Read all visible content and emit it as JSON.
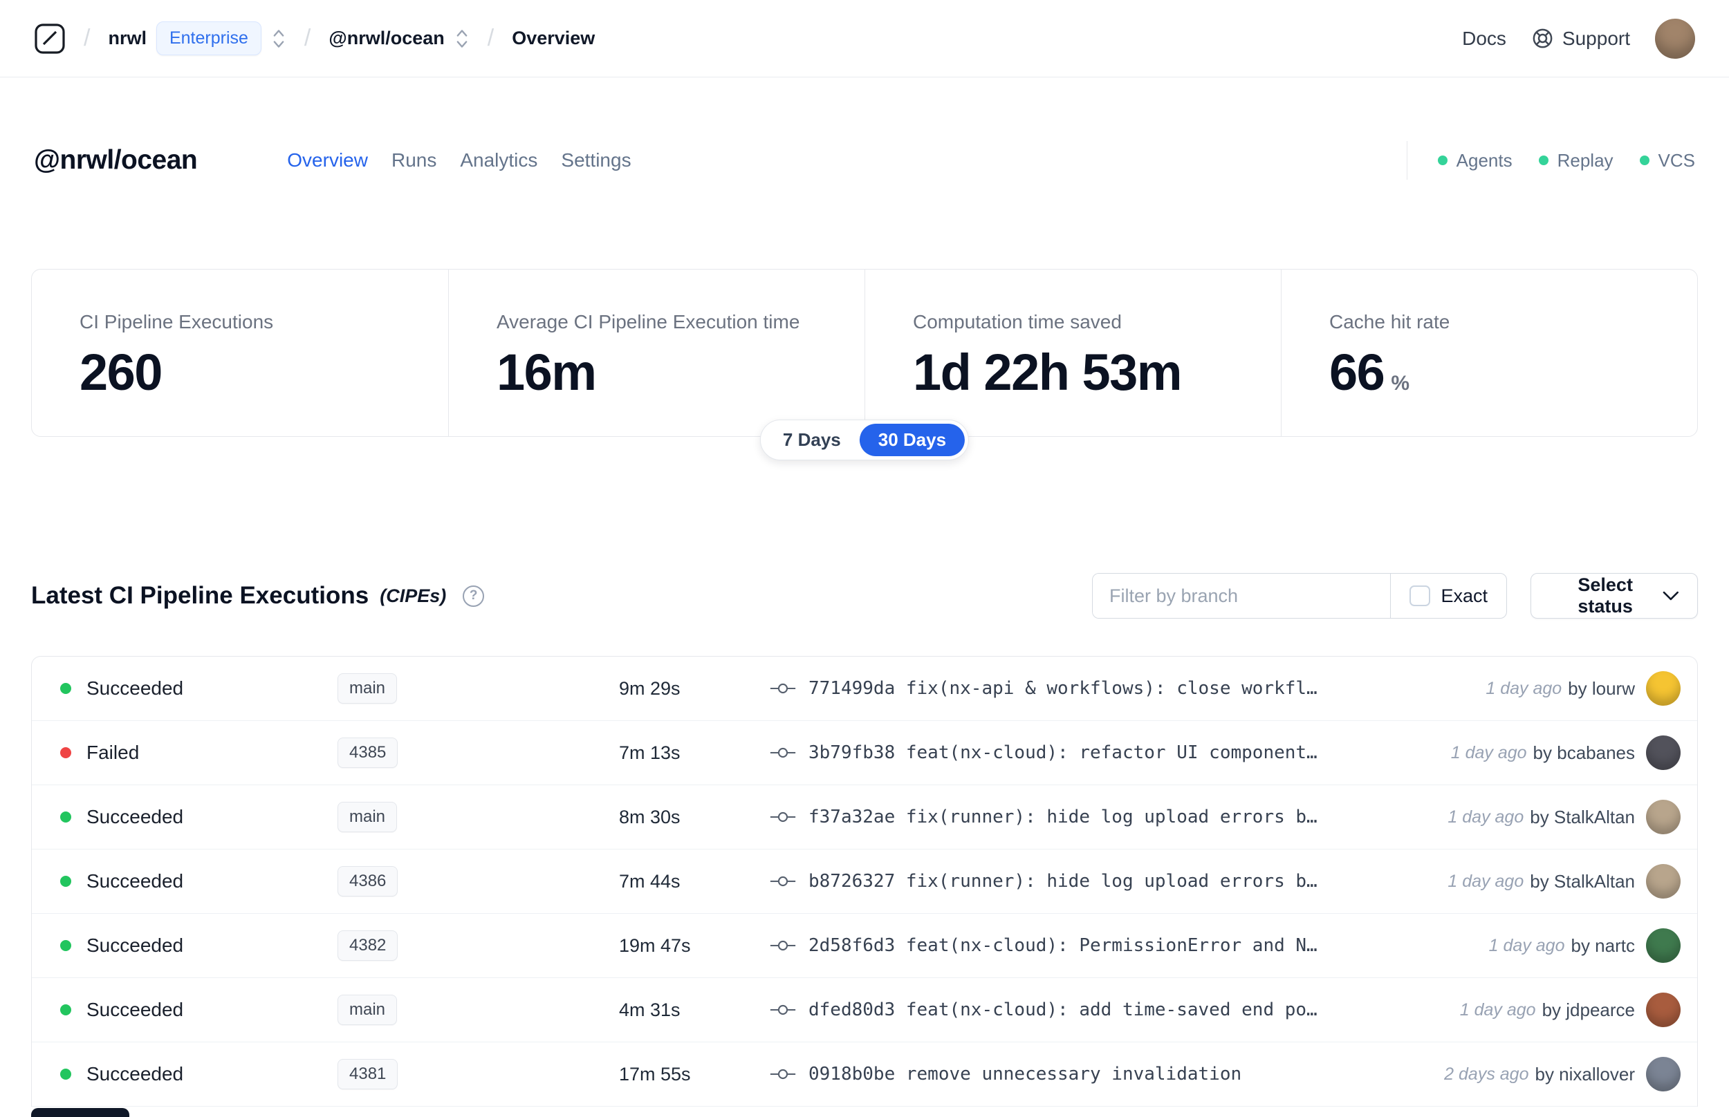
{
  "navbar": {
    "breadcrumb": {
      "separator": "/",
      "org": "nrwl",
      "org_badge": "Enterprise",
      "workspace": "@nrwl/ocean",
      "page": "Overview"
    },
    "docs_label": "Docs",
    "support_label": "Support",
    "avatar_color": "#a1846a"
  },
  "header": {
    "title": "@nrwl/ocean",
    "tabs": [
      {
        "label": "Overview"
      },
      {
        "label": "Runs"
      },
      {
        "label": "Analytics"
      },
      {
        "label": "Settings"
      }
    ],
    "active_tab": "Overview",
    "active_tab_color": "#2563eb",
    "legend": [
      {
        "label": "Agents"
      },
      {
        "label": "Replay"
      },
      {
        "label": "VCS"
      }
    ],
    "legend_dot_color": "#34d399"
  },
  "stats": {
    "cards": [
      {
        "label": "CI Pipeline Executions",
        "value": "260",
        "suffix": ""
      },
      {
        "label": "Average CI Pipeline Execution time",
        "value": "16m",
        "suffix": ""
      },
      {
        "label": "Computation time saved",
        "value": "1d 22h 53m",
        "suffix": ""
      },
      {
        "label": "Cache hit rate",
        "value": "66",
        "suffix": "%"
      }
    ],
    "range_toggle": {
      "options": [
        "7 Days",
        "30 Days"
      ],
      "selected": "30 Days",
      "selected_color": "#2563eb"
    }
  },
  "cipes": {
    "title": "Latest CI Pipeline Executions",
    "title_suffix": "(CIPEs)",
    "help_icon": "?",
    "filter_placeholder": "Filter by branch",
    "exact_label": "Exact",
    "status_select_label": "Select status",
    "status_colors": {
      "succeeded": "#22c55e",
      "failed": "#ef4444"
    },
    "rows": [
      {
        "status": "Succeeded",
        "status_color": "#22c55e",
        "branch": "main",
        "duration": "9m 29s",
        "commit": "771499da fix(nx-api & workflows): close workfl…",
        "time": "1 day ago",
        "author": "by lourw",
        "avatar_color": "#f5c432"
      },
      {
        "status": "Failed",
        "status_color": "#ef4444",
        "branch": "4385",
        "duration": "7m 13s",
        "commit": "3b79fb38 feat(nx-cloud): refactor UI component…",
        "time": "1 day ago",
        "author": "by bcabanes",
        "avatar_color": "#52525b"
      },
      {
        "status": "Succeeded",
        "status_color": "#22c55e",
        "branch": "main",
        "duration": "8m 30s",
        "commit": "f37a32ae fix(runner): hide log upload errors b…",
        "time": "1 day ago",
        "author": "by StalkAltan",
        "avatar_color": "#b8a58c"
      },
      {
        "status": "Succeeded",
        "status_color": "#22c55e",
        "branch": "4386",
        "duration": "7m 44s",
        "commit": "b8726327 fix(runner): hide log upload errors b…",
        "time": "1 day ago",
        "author": "by StalkAltan",
        "avatar_color": "#b8a58c"
      },
      {
        "status": "Succeeded",
        "status_color": "#22c55e",
        "branch": "4382",
        "duration": "19m 47s",
        "commit": "2d58f6d3 feat(nx-cloud): PermissionError and N…",
        "time": "1 day ago",
        "author": "by nartc",
        "avatar_color": "#3f7a4e"
      },
      {
        "status": "Succeeded",
        "status_color": "#22c55e",
        "branch": "main",
        "duration": "4m 31s",
        "commit": "dfed80d3 feat(nx-cloud): add time-saved end po…",
        "time": "1 day ago",
        "author": "by jdpearce",
        "avatar_color": "#a85c3e"
      },
      {
        "status": "Succeeded",
        "status_color": "#22c55e",
        "branch": "4381",
        "duration": "17m 55s",
        "commit": "0918b0be remove unnecessary invalidation",
        "time": "2 days ago",
        "author": "by nixallover",
        "avatar_color": "#7b8494"
      }
    ]
  }
}
